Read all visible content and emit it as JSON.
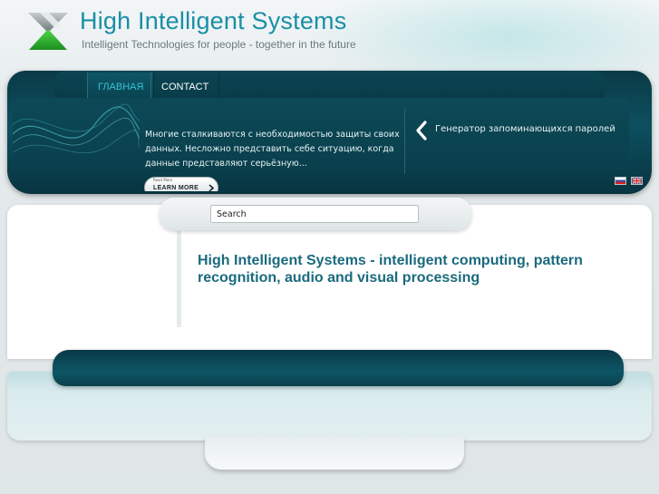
{
  "header": {
    "title": "High Intelligent Systems",
    "slogan": "Intelligent Technologies for people - together in the future",
    "logo_icon": "triangle-logo-icon"
  },
  "nav": {
    "items": [
      {
        "label": "ГЛАВНАЯ",
        "active": true
      },
      {
        "label": "CONTACT",
        "active": false
      }
    ]
  },
  "banner": {
    "text": "Многие сталкиваются с необходимостью защиты своих данных. Несложно представить себе ситуацию, когда данные представляют серьёзную...",
    "link": "Генератор запоминающихся паролей",
    "prev_icon": "chevron-left-icon",
    "learn_more_small": "Read More",
    "learn_more": "LEARN MORE"
  },
  "languages": [
    {
      "name": "ru",
      "icon": "flag-russia-icon"
    },
    {
      "name": "en",
      "icon": "flag-uk-icon"
    }
  ],
  "search": {
    "placeholder": "Search"
  },
  "content": {
    "heading": "High Intelligent Systems - intelligent computing, pattern recognition, audio and visual processing"
  },
  "colors": {
    "accent": "#1a8fa6",
    "dark_band": "#0a3a46",
    "heading": "#1a6a7e",
    "nav_active": "#35c3d8"
  }
}
